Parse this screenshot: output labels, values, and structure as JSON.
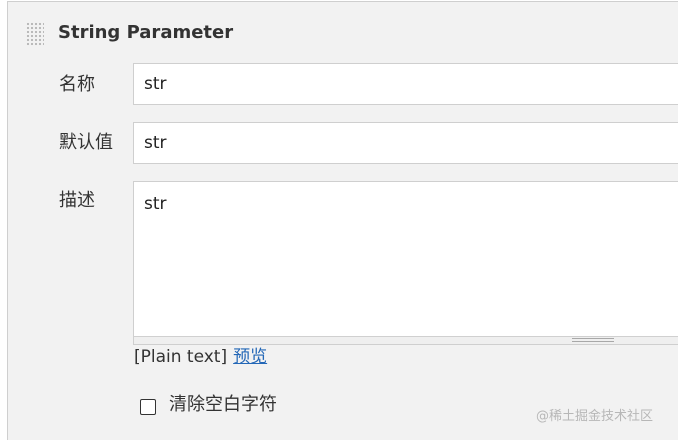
{
  "section": {
    "title": "String Parameter"
  },
  "fields": {
    "name": {
      "label": "名称",
      "value": "str"
    },
    "default_value": {
      "label": "默认值",
      "value": "str"
    },
    "description": {
      "label": "描述",
      "value": "str"
    }
  },
  "description_footer": {
    "format": "[Plain text]",
    "preview_link": "预览"
  },
  "trim_option": {
    "label": "清除空白字符",
    "checked": false
  },
  "watermark": "@稀土掘金技术社区",
  "colors": {
    "panel_bg": "#f2f2f2",
    "input_bg": "#ffffff",
    "text": "#333333",
    "link": "#2367b7",
    "border": "#cfcfcf"
  },
  "icons": {
    "drag_handle": "drag-handle-icon"
  }
}
